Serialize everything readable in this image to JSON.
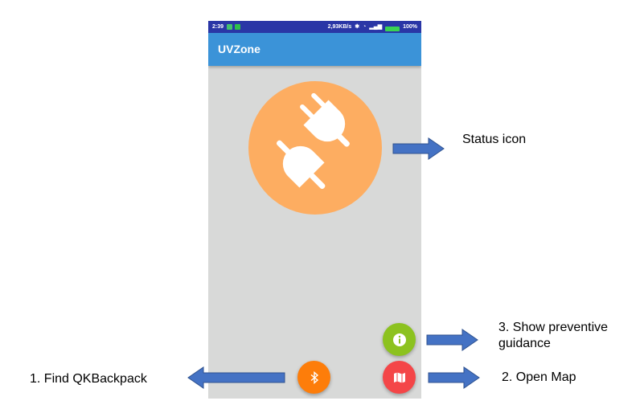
{
  "statusbar": {
    "time": "2:39",
    "network_speed": "2,93KB/s",
    "battery": "100%"
  },
  "app": {
    "title": "UVZone"
  },
  "annotations": {
    "status_icon": "Status icon",
    "show_guidance": "3. Show preventive guidance",
    "open_map": "2. Open Map",
    "find_backpack": "1. Find QKBackpack"
  },
  "colors": {
    "statusbar": "#2a36a6",
    "appbar": "#3b93d8",
    "background": "#d8d9d8",
    "status_circle": "#fdad61",
    "info_button": "#8cc21f",
    "map_button": "#f44648",
    "bluetooth_button": "#fd7d0a",
    "arrow": "#4472c4"
  },
  "icons": {
    "status": "unplugged-icon",
    "info": "info-icon",
    "map": "map-icon",
    "bluetooth": "bluetooth-icon"
  }
}
